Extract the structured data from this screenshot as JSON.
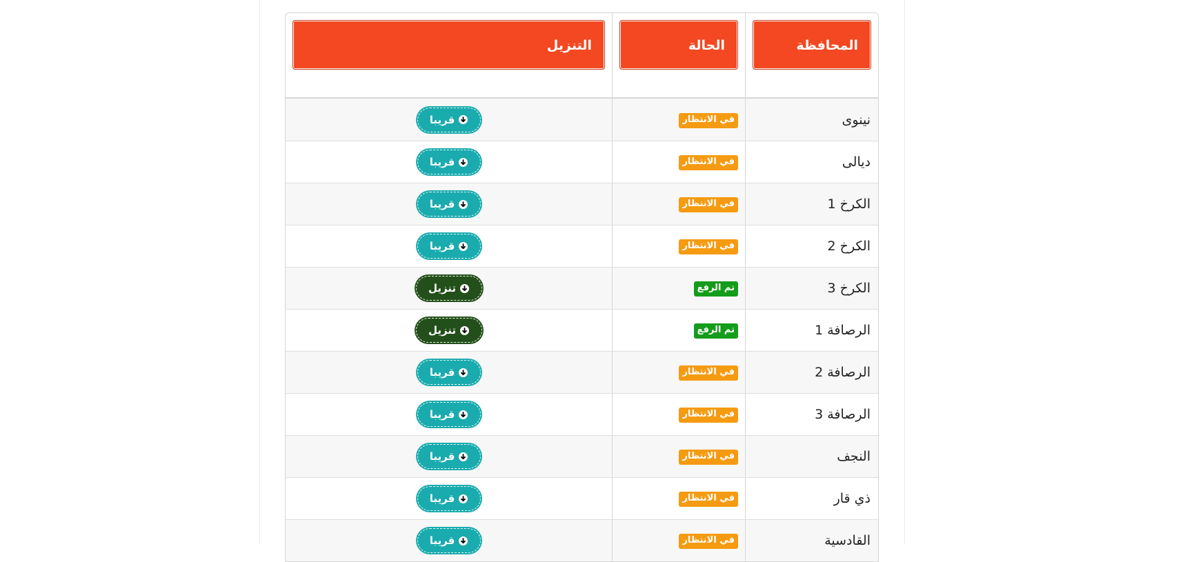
{
  "table": {
    "headers": {
      "province": "المحافظة",
      "status": "الحالة",
      "download": "التنزيل"
    },
    "rows": [
      {
        "province": "نينوى",
        "status": "في الانتظار",
        "status_type": "waiting",
        "button": "قريبا",
        "button_type": "soon"
      },
      {
        "province": "ديالى",
        "status": "في الانتظار",
        "status_type": "waiting",
        "button": "قريبا",
        "button_type": "soon"
      },
      {
        "province": "الكرخ 1",
        "status": "في الانتظار",
        "status_type": "waiting",
        "button": "قريبا",
        "button_type": "soon"
      },
      {
        "province": "الكرخ 2",
        "status": "في الانتظار",
        "status_type": "waiting",
        "button": "قريبا",
        "button_type": "soon"
      },
      {
        "province": "الكرخ 3",
        "status": "تم الرفع",
        "status_type": "uploaded",
        "button": "تنزيل",
        "button_type": "ready"
      },
      {
        "province": "الرصافة 1",
        "status": "تم الرفع",
        "status_type": "uploaded",
        "button": "تنزيل",
        "button_type": "ready"
      },
      {
        "province": "الرصافة 2",
        "status": "في الانتظار",
        "status_type": "waiting",
        "button": "قريبا",
        "button_type": "soon"
      },
      {
        "province": "الرصافة 3",
        "status": "في الانتظار",
        "status_type": "waiting",
        "button": "قريبا",
        "button_type": "soon"
      },
      {
        "province": "النجف",
        "status": "في الانتظار",
        "status_type": "waiting",
        "button": "قريبا",
        "button_type": "soon"
      },
      {
        "province": "ذي قار",
        "status": "في الانتظار",
        "status_type": "waiting",
        "button": "قريبا",
        "button_type": "soon"
      },
      {
        "province": "القادسية",
        "status": "في الانتظار",
        "status_type": "waiting",
        "button": "قريبا",
        "button_type": "soon"
      }
    ]
  },
  "icons": {
    "download": "arrow-circle-down-icon"
  },
  "colors": {
    "header": "#f34822",
    "waiting": "#f59b12",
    "uploaded": "#149c1b",
    "soon_button": "#1aabae",
    "ready_button": "#23501a"
  }
}
